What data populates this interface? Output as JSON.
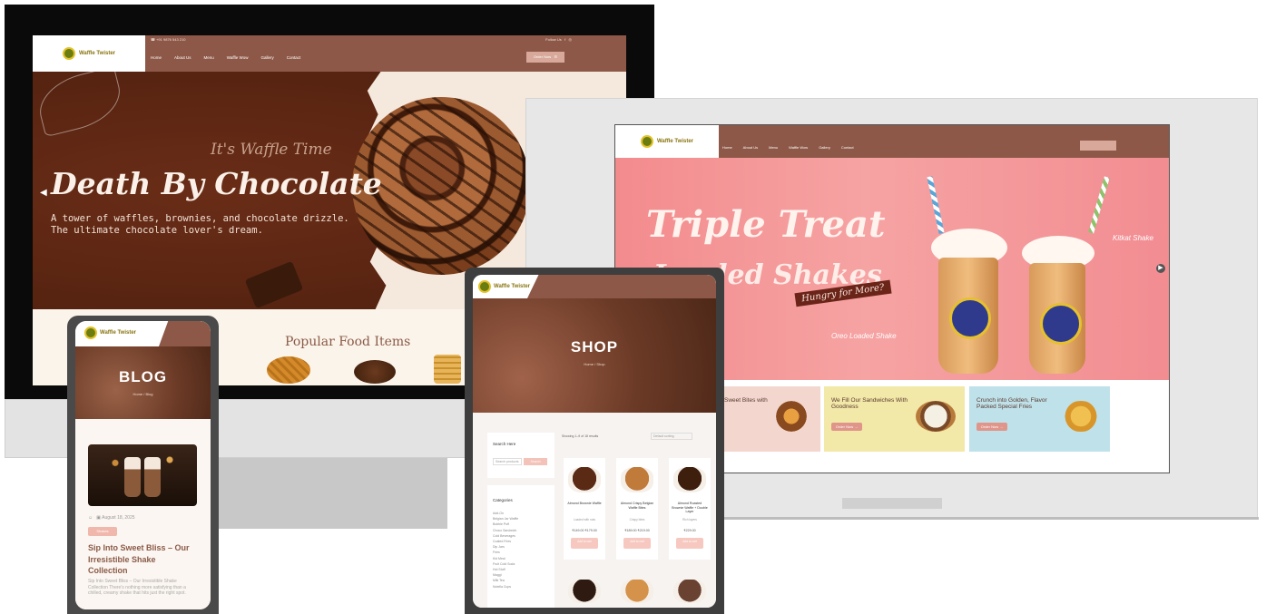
{
  "desktop": {
    "topbar": {
      "contact": "☎ +91 9876 543 210",
      "social": "Follow Us   f   ◎"
    },
    "logo": "Waffle Twister",
    "nav": [
      "Home",
      "About Us",
      "Menu",
      "Waffle Wow",
      "Gallery",
      "Contact"
    ],
    "cart_label": "Order Now   ☰",
    "hero": {
      "pretitle": "It's Waffle Time",
      "title": "Death By Chocolate",
      "subtitle": "A tower of waffles, brownies, and chocolate drizzle. The ultimate chocolate lover's dream."
    },
    "section_title": "Popular Food Items"
  },
  "laptop": {
    "logo": "Waffle Twister",
    "nav": [
      "Home",
      "About Us",
      "Menu",
      "Waffle Wow",
      "Gallery",
      "Contact"
    ],
    "hero": {
      "title": "Triple Treat",
      "title2": "Loaded Shakes",
      "tag": "Hungry for More?",
      "label_left": "Oreo Loaded Shake",
      "label_right": "Kitkat Shake"
    },
    "cards": [
      {
        "title": "Sweet Bites with",
        "button": "Order Now →"
      },
      {
        "title": "We Fill Our Sandwiches With Goodness",
        "button": "Order Now →"
      },
      {
        "title": "Crunch into Golden, Flavor Packed Special Fries",
        "button": "Order Now →"
      }
    ]
  },
  "phone": {
    "logo": "Waffle Twister",
    "banner_title": "BLOG",
    "breadcrumb": "Home / Blog",
    "meta": "☺   ▣ August 18, 2025",
    "tag": "Shakes",
    "post_title": "Sip Into Sweet Bliss – Our Irresistible Shake Collection",
    "excerpt": "Sip Into Sweet Bliss – Our Irresistible Shake Collection There's nothing more satisfying than a chilled, creamy shake that hits just the right spot."
  },
  "tablet": {
    "logo": "Waffle Twister",
    "banner_title": "SHOP",
    "breadcrumb": "Home / Shop",
    "search": {
      "heading": "Search Here",
      "placeholder": "Search products",
      "button": "Search"
    },
    "categories_heading": "Categories",
    "categories": [
      "Add-On",
      "Belgian Jar Waffle",
      "Bubble Puff",
      "Choco Sandwich",
      "Cold Beverages",
      "Coated Fries",
      "Dip Jars",
      "Fries",
      "Kid Meal",
      "Fruit Cold Soda",
      "Hot Stuff",
      "Maggi",
      "Milk Tea",
      "Nutella Cups"
    ],
    "sort_text": "Showing 1–9 of 18 results",
    "sort_select": "Default sorting",
    "products": [
      {
        "name": "Almond Brownie Waffle",
        "desc": "Loaded with nuts",
        "price": "₹149.00 ₹179.00",
        "button": "Add to cart",
        "color": "#5a2a14"
      },
      {
        "name": "Almond Crispy Belgian Waffle Bites",
        "desc": "Crispy bites",
        "price": "₹189.00 ₹219.00",
        "button": "Add to cart",
        "color": "#c07a3a"
      },
      {
        "name": "Almond Roasted Brownie Waffle + Double Layer",
        "desc": "Rich layers",
        "price": "₹229.00",
        "button": "Add to cart",
        "color": "#3e1e0c"
      }
    ],
    "products_row2_colors": [
      "#2e1a10",
      "#d4924a",
      "#6a4232"
    ]
  }
}
